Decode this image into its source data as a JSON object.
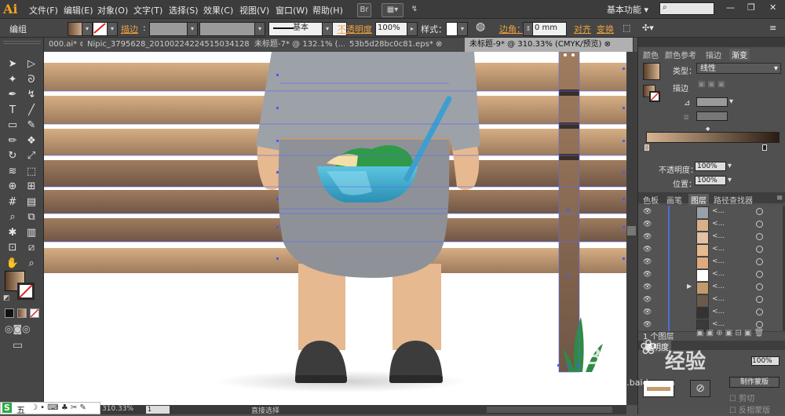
{
  "app": {
    "logo": "Ai"
  },
  "menu": [
    "文件(F)",
    "编辑(E)",
    "对象(O)",
    "文字(T)",
    "选择(S)",
    "效果(C)",
    "视图(V)",
    "窗口(W)",
    "帮助(H)"
  ],
  "menubar_right": {
    "br_label": "Br",
    "workspace": "基本功能",
    "search_placeholder": ""
  },
  "control": {
    "group_label": "编组",
    "stroke_label": "描边",
    "stroke_style": "基本",
    "opacity_label": "不透明度",
    "opacity_value": "100%",
    "style_label": "样式",
    "corner_label": "边角",
    "corner_value": "0 mm",
    "align_label": "对齐",
    "transform_label": "变换"
  },
  "tabs": [
    {
      "label": "000.ai* ⊗",
      "active": false
    },
    {
      "label": "Nipic_3795628_20100224224515034128.ai* ⊗",
      "active": false
    },
    {
      "label": "未标题-7* @ 132.1% (…",
      "active": false
    },
    {
      "label": "53b5d28bc0c81.eps* ⊗",
      "active": false
    },
    {
      "label": "未标题-9* @ 310.33% (CMYK/预览) ⊗",
      "active": true
    }
  ],
  "tools": [
    {
      "name": "selection-tool",
      "glyph": "➤"
    },
    {
      "name": "direct-selection-tool",
      "glyph": "▷"
    },
    {
      "name": "magic-wand-tool",
      "glyph": "✦"
    },
    {
      "name": "lasso-tool",
      "glyph": "ᘐ"
    },
    {
      "name": "pen-tool",
      "glyph": "✒"
    },
    {
      "name": "curvature-tool",
      "glyph": "↯"
    },
    {
      "name": "type-tool",
      "glyph": "T"
    },
    {
      "name": "line-tool",
      "glyph": "╱"
    },
    {
      "name": "rectangle-tool",
      "glyph": "▭"
    },
    {
      "name": "paintbrush-tool",
      "glyph": "✎"
    },
    {
      "name": "pencil-tool",
      "glyph": "✏"
    },
    {
      "name": "blob-brush-tool",
      "glyph": "❖"
    },
    {
      "name": "rotate-tool",
      "glyph": "↻"
    },
    {
      "name": "scale-tool",
      "glyph": "⤢"
    },
    {
      "name": "warp-tool",
      "glyph": "≋"
    },
    {
      "name": "free-transform-tool",
      "glyph": "⬚"
    },
    {
      "name": "shape-builder-tool",
      "glyph": "⊕"
    },
    {
      "name": "perspective-grid-tool",
      "glyph": "⊞"
    },
    {
      "name": "mesh-tool",
      "glyph": "#"
    },
    {
      "name": "gradient-tool",
      "glyph": "▤"
    },
    {
      "name": "eyedropper-tool",
      "glyph": "⌕"
    },
    {
      "name": "blend-tool",
      "glyph": "⧉"
    },
    {
      "name": "symbol-sprayer-tool",
      "glyph": "✱"
    },
    {
      "name": "column-graph-tool",
      "glyph": "▥"
    },
    {
      "name": "artboard-tool",
      "glyph": "⊡"
    },
    {
      "name": "slice-tool",
      "glyph": "⧄"
    },
    {
      "name": "hand-tool",
      "glyph": "✋"
    },
    {
      "name": "zoom-tool",
      "glyph": "⌕"
    }
  ],
  "panels": {
    "top_tabs": [
      "颜色",
      "颜色参考",
      "描边",
      "渐变"
    ],
    "gradient": {
      "type_label": "类型",
      "type_value": "线性",
      "stroke_label": "描边",
      "opacity_label": "不透明度",
      "opacity_value": "100%",
      "position_label": "位置",
      "position_value": "100%"
    },
    "mid_tabs": [
      "色板",
      "画笔",
      "图层",
      "路径查找器"
    ],
    "layers_footer": "1 个图层",
    "transparency": {
      "tab_label": "透明度",
      "opacity_value": "100%",
      "make_mask_label": "制作蒙版",
      "clip_label": "剪切",
      "invert_label": "反相蒙版"
    }
  },
  "layers": [
    {
      "name": "<...",
      "thumb": "#9aa0a8"
    },
    {
      "name": "<...",
      "thumb": "#d9b08a"
    },
    {
      "name": "<...",
      "thumb": "#e2c1a4"
    },
    {
      "name": "<...",
      "thumb": "#e6b98f"
    },
    {
      "name": "<...",
      "thumb": "#e0a880"
    },
    {
      "name": "<...",
      "thumb": "#ffffff"
    },
    {
      "name": "<...",
      "thumb": "#c29a6e"
    },
    {
      "name": "<...",
      "thumb": "#6b5a4a"
    },
    {
      "name": "<...",
      "thumb": "#333333"
    },
    {
      "name": "<...",
      "thumb": "#3a3a3a"
    }
  ],
  "status": {
    "zoom": "310.33%",
    "page": "1",
    "tool_status": "直接选择"
  },
  "ime": {
    "label": "五"
  },
  "watermark": {
    "brand": "Bai",
    "brand2": "经验",
    "url": "jingyan.baidu.com"
  },
  "colors": {
    "accent_orange": "#f7a21b",
    "bench_light": "#d2aa80",
    "bench_dark": "#8e6b50",
    "shirt": "#9da1a8",
    "skin": "#e6b990",
    "shoe": "#3a3a3a",
    "bowl": "#3aa7c9",
    "salad": "#2f9a48"
  }
}
